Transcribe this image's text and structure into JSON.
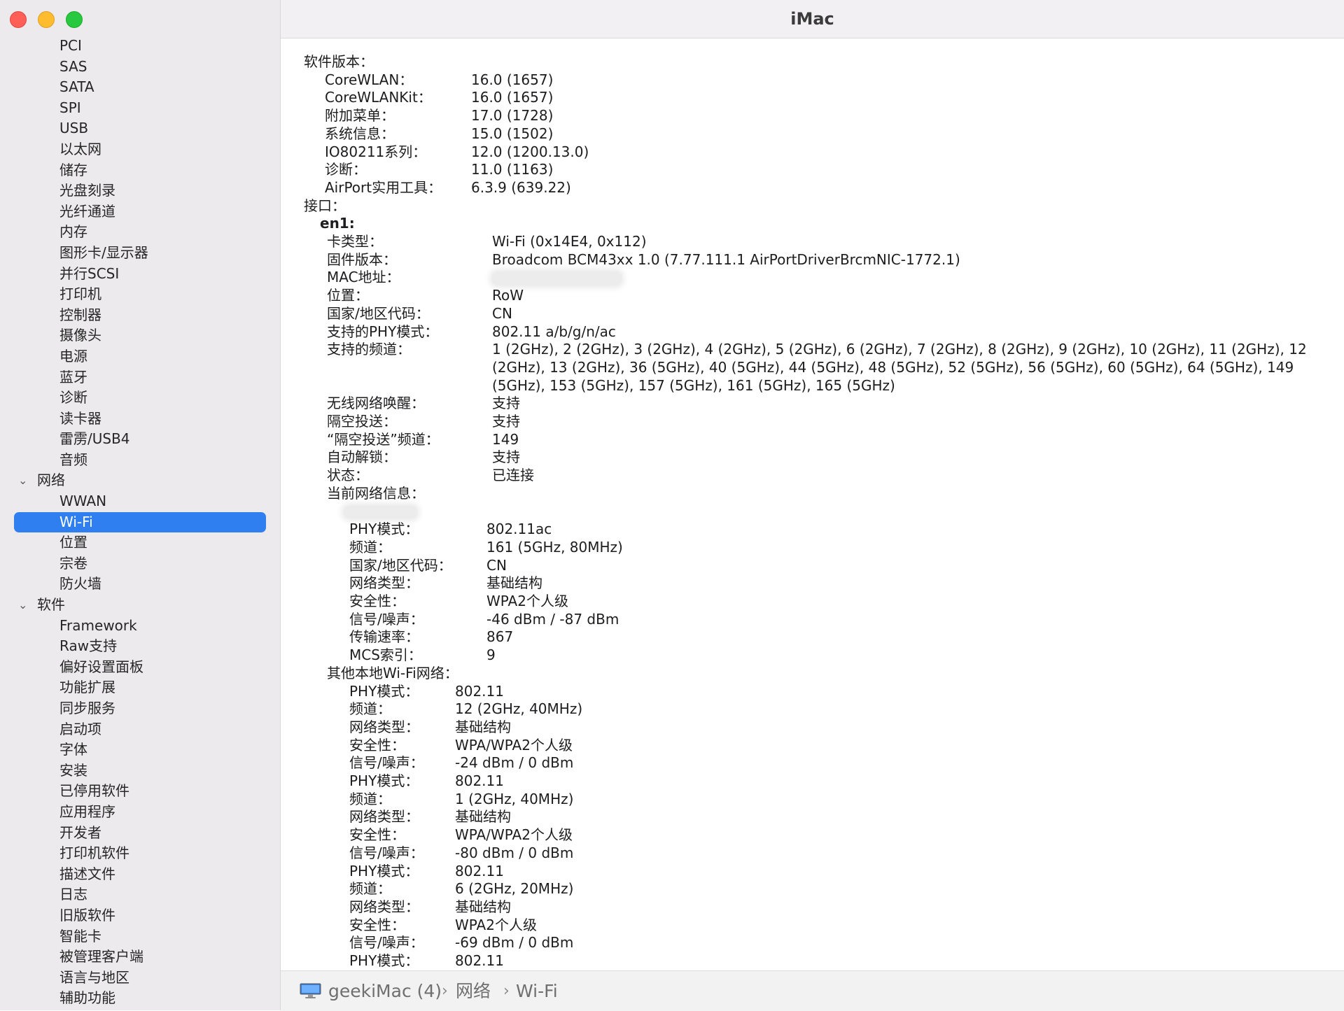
{
  "window": {
    "title": "iMac"
  },
  "sidebar": {
    "items": [
      {
        "label": "PCI",
        "type": "child"
      },
      {
        "label": "SAS",
        "type": "child"
      },
      {
        "label": "SATA",
        "type": "child"
      },
      {
        "label": "SPI",
        "type": "child"
      },
      {
        "label": "USB",
        "type": "child"
      },
      {
        "label": "以太网",
        "type": "child"
      },
      {
        "label": "储存",
        "type": "child"
      },
      {
        "label": "光盘刻录",
        "type": "child"
      },
      {
        "label": "光纤通道",
        "type": "child"
      },
      {
        "label": "内存",
        "type": "child"
      },
      {
        "label": "图形卡/显示器",
        "type": "child"
      },
      {
        "label": "并行SCSI",
        "type": "child"
      },
      {
        "label": "打印机",
        "type": "child"
      },
      {
        "label": "控制器",
        "type": "child"
      },
      {
        "label": "摄像头",
        "type": "child"
      },
      {
        "label": "电源",
        "type": "child"
      },
      {
        "label": "蓝牙",
        "type": "child"
      },
      {
        "label": "诊断",
        "type": "child"
      },
      {
        "label": "读卡器",
        "type": "child"
      },
      {
        "label": "雷雳/USB4",
        "type": "child"
      },
      {
        "label": "音频",
        "type": "child"
      },
      {
        "label": "网络",
        "type": "group"
      },
      {
        "label": "WWAN",
        "type": "child"
      },
      {
        "label": "Wi-Fi",
        "type": "child",
        "selected": true
      },
      {
        "label": "位置",
        "type": "child"
      },
      {
        "label": "宗卷",
        "type": "child"
      },
      {
        "label": "防火墙",
        "type": "child"
      },
      {
        "label": "软件",
        "type": "group"
      },
      {
        "label": "Framework",
        "type": "child"
      },
      {
        "label": "Raw支持",
        "type": "child"
      },
      {
        "label": "偏好设置面板",
        "type": "child"
      },
      {
        "label": "功能扩展",
        "type": "child"
      },
      {
        "label": "同步服务",
        "type": "child"
      },
      {
        "label": "启动项",
        "type": "child"
      },
      {
        "label": "字体",
        "type": "child"
      },
      {
        "label": "安装",
        "type": "child"
      },
      {
        "label": "已停用软件",
        "type": "child"
      },
      {
        "label": "应用程序",
        "type": "child"
      },
      {
        "label": "开发者",
        "type": "child"
      },
      {
        "label": "打印机软件",
        "type": "child"
      },
      {
        "label": "描述文件",
        "type": "child"
      },
      {
        "label": "日志",
        "type": "child"
      },
      {
        "label": "旧版软件",
        "type": "child"
      },
      {
        "label": "智能卡",
        "type": "child"
      },
      {
        "label": "被管理客户端",
        "type": "child"
      },
      {
        "label": "语言与地区",
        "type": "child"
      },
      {
        "label": "辅助功能",
        "type": "child"
      }
    ]
  },
  "content": {
    "rows": [
      {
        "k": "软件版本：",
        "v": "",
        "lvl": 0
      },
      {
        "k": "CoreWLAN：",
        "v": "16.0 (1657)",
        "lvl": 1
      },
      {
        "k": "CoreWLANKit：",
        "v": "16.0 (1657)",
        "lvl": 1
      },
      {
        "k": "附加菜单：",
        "v": "17.0 (1728)",
        "lvl": 1
      },
      {
        "k": "系统信息：",
        "v": "15.0 (1502)",
        "lvl": 1
      },
      {
        "k": "IO80211系列：",
        "v": "12.0 (1200.13.0)",
        "lvl": 1
      },
      {
        "k": "诊断：",
        "v": "11.0 (1163)",
        "lvl": 1
      },
      {
        "k": "AirPort实用工具：",
        "v": "6.3.9 (639.22)",
        "lvl": 1
      },
      {
        "k": "接口：",
        "v": "",
        "lvl": 0
      },
      {
        "k": "en1:",
        "v": "",
        "lvl": 2,
        "bold": true
      },
      {
        "k": "卡类型：",
        "v": "Wi-Fi  (0x14E4, 0x112)",
        "lvl": 3
      },
      {
        "k": "固件版本：",
        "v": "Broadcom BCM43xx 1.0 (7.77.111.1 AirPortDriverBrcmNIC-1772.1)",
        "lvl": 3
      },
      {
        "k": "MAC地址：",
        "v": "",
        "lvl": 3,
        "blurred": true
      },
      {
        "k": "位置：",
        "v": "RoW",
        "lvl": 3
      },
      {
        "k": "国家/地区代码：",
        "v": "CN",
        "lvl": 3
      },
      {
        "k": "支持的PHY模式：",
        "v": "802.11 a/b/g/n/ac",
        "lvl": 3
      },
      {
        "k": "支持的频道：",
        "v": "1 (2GHz), 2 (2GHz), 3 (2GHz), 4 (2GHz), 5 (2GHz), 6 (2GHz), 7 (2GHz), 8 (2GHz), 9 (2GHz), 10 (2GHz), 11 (2GHz), 12 (2GHz), 13 (2GHz), 36 (5GHz), 40 (5GHz), 44 (5GHz), 48 (5GHz), 52 (5GHz), 56 (5GHz), 60 (5GHz), 64 (5GHz), 149 (5GHz), 153 (5GHz), 157 (5GHz), 161 (5GHz), 165 (5GHz)",
        "lvl": 3,
        "wrap": true
      },
      {
        "k": "无线网络唤醒：",
        "v": "支持",
        "lvl": 3
      },
      {
        "k": "隔空投送：",
        "v": "支持",
        "lvl": 3
      },
      {
        "k": "“隔空投送”频道：",
        "v": "149",
        "lvl": 3
      },
      {
        "k": "自动解锁：",
        "v": "支持",
        "lvl": 3
      },
      {
        "k": "状态：",
        "v": "已连接",
        "lvl": 3
      },
      {
        "k": "当前网络信息：",
        "v": "",
        "lvl": 3
      },
      {
        "k": "",
        "v": "",
        "lvl": 4,
        "ssid": true
      },
      {
        "k": "PHY模式：",
        "v": "802.11ac",
        "lvl": 5
      },
      {
        "k": "频道：",
        "v": "161 (5GHz, 80MHz)",
        "lvl": 5
      },
      {
        "k": "国家/地区代码：",
        "v": "CN",
        "lvl": 5
      },
      {
        "k": "网络类型：",
        "v": "基础结构",
        "lvl": 5
      },
      {
        "k": "安全性：",
        "v": "WPA2个人级",
        "lvl": 5
      },
      {
        "k": "信号/噪声：",
        "v": "-46 dBm / -87 dBm",
        "lvl": 5
      },
      {
        "k": "传输速率：",
        "v": "867",
        "lvl": 5
      },
      {
        "k": "MCS索引：",
        "v": "9",
        "lvl": 5
      },
      {
        "k": "其他本地Wi-Fi网络：",
        "v": "",
        "lvl": 3
      },
      {
        "k": "PHY模式：",
        "v": "802.11",
        "lvl": 6
      },
      {
        "k": "频道：",
        "v": "12 (2GHz, 40MHz)",
        "lvl": 6
      },
      {
        "k": "网络类型：",
        "v": "基础结构",
        "lvl": 6
      },
      {
        "k": "安全性：",
        "v": "WPA/WPA2个人级",
        "lvl": 6
      },
      {
        "k": "信号/噪声：",
        "v": "-24 dBm / 0 dBm",
        "lvl": 6
      },
      {
        "k": "PHY模式：",
        "v": "802.11",
        "lvl": 6
      },
      {
        "k": "频道：",
        "v": "1 (2GHz, 40MHz)",
        "lvl": 6
      },
      {
        "k": "网络类型：",
        "v": "基础结构",
        "lvl": 6
      },
      {
        "k": "安全性：",
        "v": "WPA/WPA2个人级",
        "lvl": 6
      },
      {
        "k": "信号/噪声：",
        "v": "-80 dBm / 0 dBm",
        "lvl": 6
      },
      {
        "k": "PHY模式：",
        "v": "802.11",
        "lvl": 6
      },
      {
        "k": "频道：",
        "v": "6 (2GHz, 20MHz)",
        "lvl": 6
      },
      {
        "k": "网络类型：",
        "v": "基础结构",
        "lvl": 6
      },
      {
        "k": "安全性：",
        "v": "WPA2个人级",
        "lvl": 6
      },
      {
        "k": "信号/噪声：",
        "v": "-69 dBm / 0 dBm",
        "lvl": 6
      },
      {
        "k": "PHY模式：",
        "v": "802.11",
        "lvl": 6
      }
    ]
  },
  "pathbar": {
    "icon": "imac-icon",
    "segments": [
      "geekiMac (4)",
      "网络",
      "Wi-Fi"
    ],
    "separator": "›"
  },
  "colors": {
    "selection": "#2f7ff0",
    "sidebar_bg": "#eceaec"
  }
}
